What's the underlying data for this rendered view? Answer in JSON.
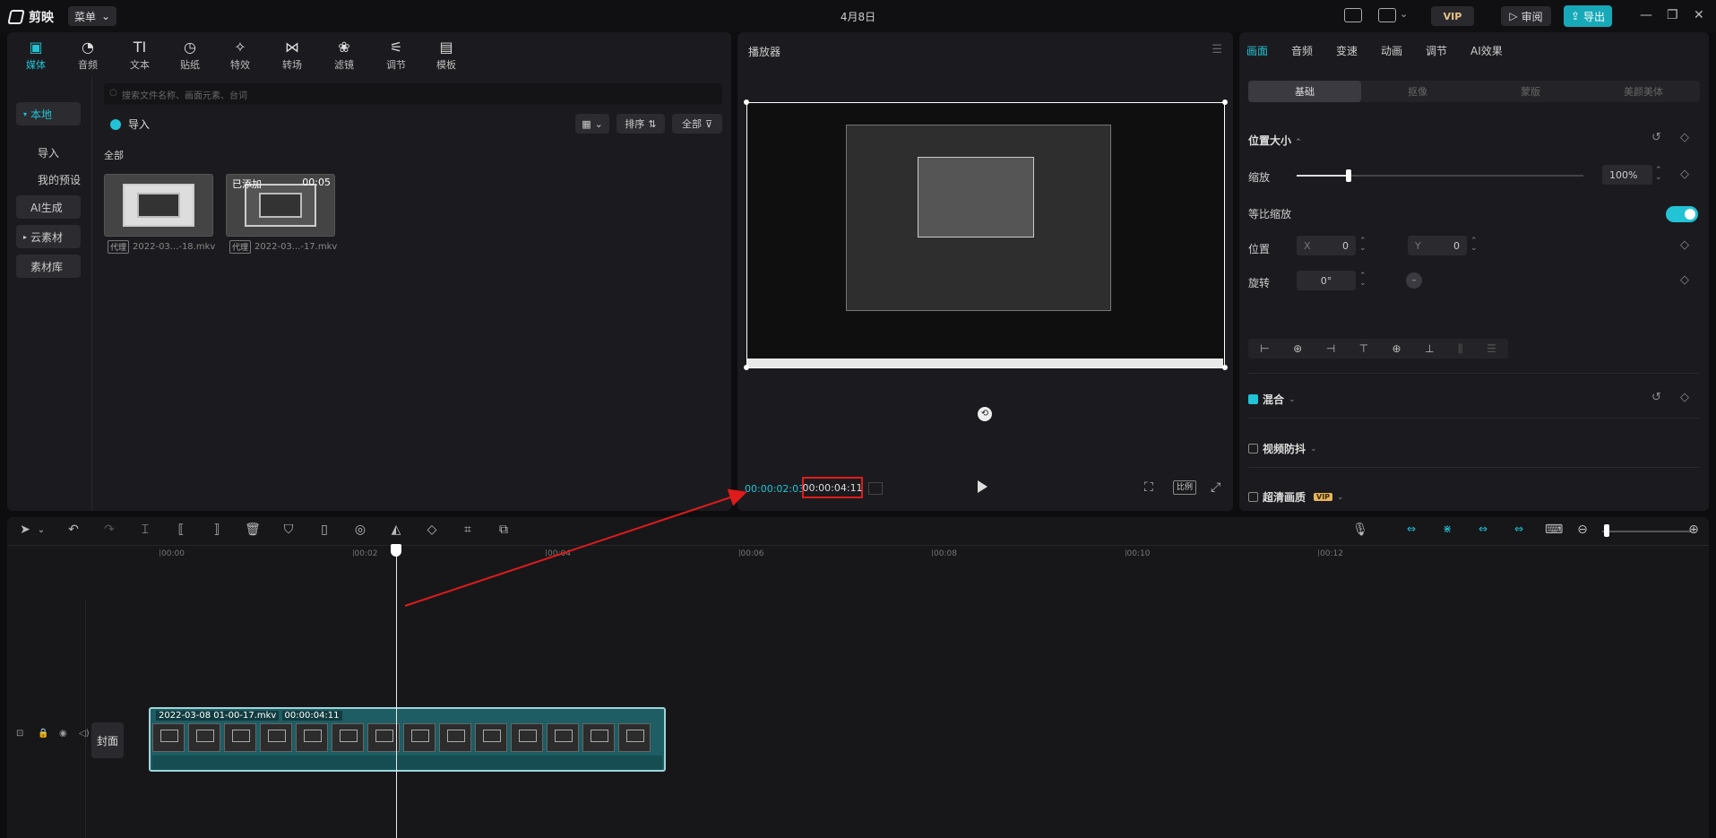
{
  "titlebar": {
    "app_name": "剪映",
    "menu_label": "菜单",
    "center_title": "4月8日",
    "vip_label": "VIP",
    "review_label": "审阅",
    "export_label": "导出"
  },
  "media": {
    "tabs": [
      {
        "label": "媒体",
        "icon": "▣"
      },
      {
        "label": "音频",
        "icon": "◔"
      },
      {
        "label": "文本",
        "icon": "TI"
      },
      {
        "label": "贴纸",
        "icon": "◷"
      },
      {
        "label": "特效",
        "icon": "✧"
      },
      {
        "label": "转场",
        "icon": "⋈"
      },
      {
        "label": "滤镜",
        "icon": "❀"
      },
      {
        "label": "调节",
        "icon": "⚟"
      },
      {
        "label": "模板",
        "icon": "▤"
      }
    ],
    "side_items": [
      "本地",
      "导入",
      "我的预设",
      "AI生成",
      "云素材",
      "素材库"
    ],
    "search_placeholder": "搜索文件名称、画面元素、台词",
    "import_label": "导入",
    "sort_label": "排序",
    "filter_label": "全部",
    "section_label": "全部",
    "items": [
      {
        "name": "2022-03...-18.mkv",
        "proxy": "代理",
        "overlay": "",
        "duration": ""
      },
      {
        "name": "2022-03...-17.mkv",
        "proxy": "代理",
        "overlay": "已添加",
        "duration": "00:05"
      }
    ]
  },
  "player": {
    "title": "播放器",
    "current_time": "00:00:02:03",
    "total_time": "00:00:04:11",
    "ratio_label": "比例"
  },
  "props": {
    "tabs": [
      "画面",
      "音频",
      "变速",
      "动画",
      "调节",
      "AI效果"
    ],
    "sub_tabs": [
      "基础",
      "抠像",
      "蒙版",
      "美颜美体"
    ],
    "section_position": "位置大小",
    "scale_label": "缩放",
    "scale_value": "100%",
    "scale_level": 1.0,
    "uniform_label": "等比缩放",
    "position_label": "位置",
    "pos_x_label": "X",
    "pos_x": "0",
    "pos_y_label": "Y",
    "pos_y": "0",
    "rotate_label": "旋转",
    "rotate_value": "0°",
    "blend_label": "混合",
    "stabilize_label": "视频防抖",
    "hd_label": "超清画质",
    "vip_tag": "VIP"
  },
  "timeline": {
    "ruler": [
      "00:00",
      "00:02",
      "00:04",
      "00:06",
      "00:08",
      "00:10",
      "00:12"
    ],
    "cover_label": "封面",
    "clip_name": "2022-03-08 01-00-17.mkv",
    "clip_duration": "00:00:04:11"
  },
  "colors": {
    "accent": "#22c3d4",
    "highlight_box": "#e01b1b",
    "clip_fill": "#1d5d63"
  }
}
